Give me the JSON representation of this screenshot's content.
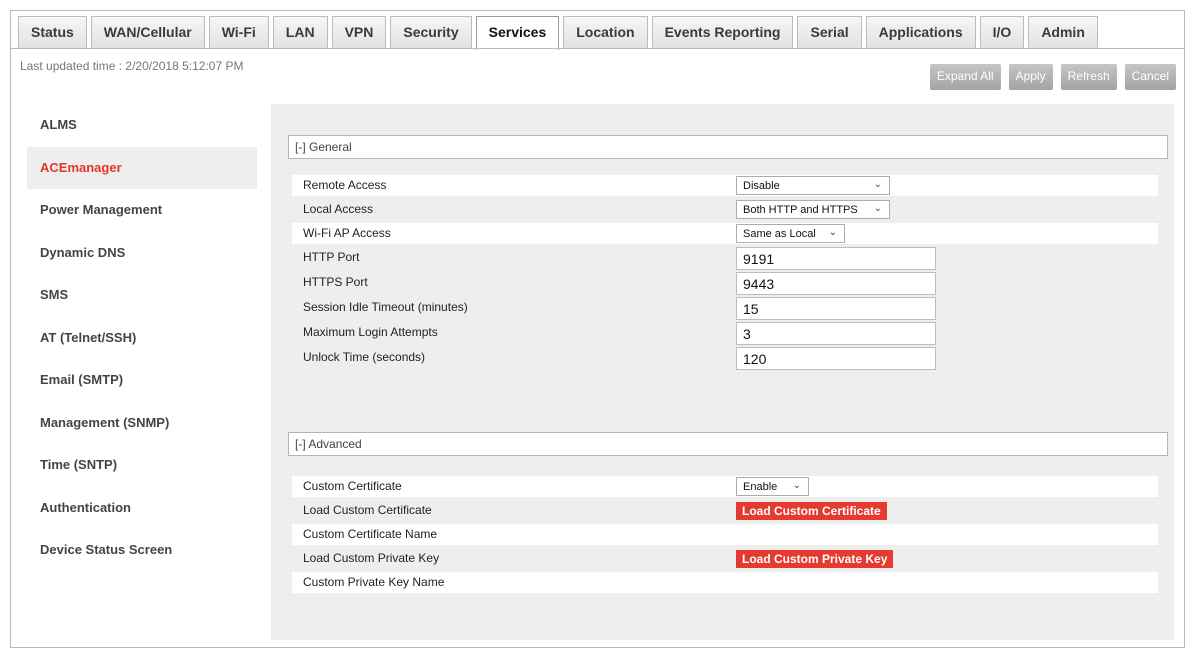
{
  "tabs": [
    "Status",
    "WAN/Cellular",
    "Wi-Fi",
    "LAN",
    "VPN",
    "Security",
    "Services",
    "Location",
    "Events Reporting",
    "Serial",
    "Applications",
    "I/O",
    "Admin"
  ],
  "active_tab": "Services",
  "last_updated": "Last updated time : 2/20/2018 5:12:07 PM",
  "buttons": {
    "expand_all": "Expand All",
    "apply": "Apply",
    "refresh": "Refresh",
    "cancel": "Cancel"
  },
  "sidebar": [
    "ALMS",
    "ACEmanager",
    "Power Management",
    "Dynamic DNS",
    "SMS",
    "AT (Telnet/SSH)",
    "Email (SMTP)",
    "Management (SNMP)",
    "Time (SNTP)",
    "Authentication",
    "Device Status Screen"
  ],
  "sidebar_active": "ACEmanager",
  "general": {
    "header": "[-] General",
    "remote_access": {
      "label": "Remote Access",
      "value": "Disable"
    },
    "local_access": {
      "label": "Local Access",
      "value": "Both HTTP and HTTPS"
    },
    "wifi_ap_access": {
      "label": "Wi-Fi AP Access",
      "value": "Same as Local"
    },
    "http_port": {
      "label": "HTTP Port",
      "value": "9191"
    },
    "https_port": {
      "label": "HTTPS Port",
      "value": "9443"
    },
    "session_idle_timeout": {
      "label": "Session Idle Timeout (minutes)",
      "value": "15"
    },
    "max_login_attempts": {
      "label": "Maximum Login Attempts",
      "value": "3"
    },
    "unlock_time": {
      "label": "Unlock Time (seconds)",
      "value": "120"
    }
  },
  "advanced": {
    "header": "[-] Advanced",
    "custom_certificate": {
      "label": "Custom Certificate",
      "value": "Enable"
    },
    "load_custom_certificate": {
      "label": "Load Custom Certificate",
      "button": "Load Custom Certificate"
    },
    "custom_certificate_name": {
      "label": "Custom Certificate Name"
    },
    "load_custom_private_key": {
      "label": "Load Custom Private Key",
      "button": "Load Custom Private Key"
    },
    "custom_private_key_name": {
      "label": "Custom Private Key Name"
    }
  },
  "colors": {
    "accent": "#e0392a",
    "button_red": "#e53a2f",
    "panel_bg": "#eeeeee"
  }
}
